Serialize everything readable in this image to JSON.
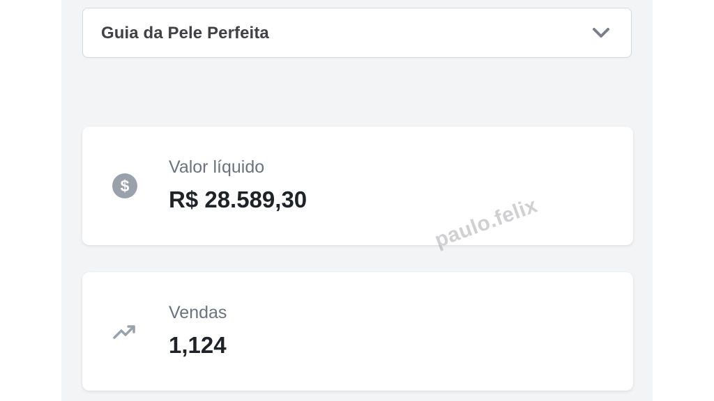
{
  "product_select": {
    "selected": "Guia da Pele Perfeita",
    "icon": "chevron-down-icon"
  },
  "cards": [
    {
      "icon": "dollar-coin-icon",
      "label": "Valor líquido",
      "value": "R$ 28.589,30"
    },
    {
      "icon": "trending-up-icon",
      "label": "Vendas",
      "value": "1,124"
    }
  ],
  "watermark": "paulo.felix",
  "colors": {
    "background": "#f3f4f6",
    "card": "#ffffff",
    "icon": "#9aa1ab",
    "label": "#6b7280",
    "value": "#1f2328"
  }
}
